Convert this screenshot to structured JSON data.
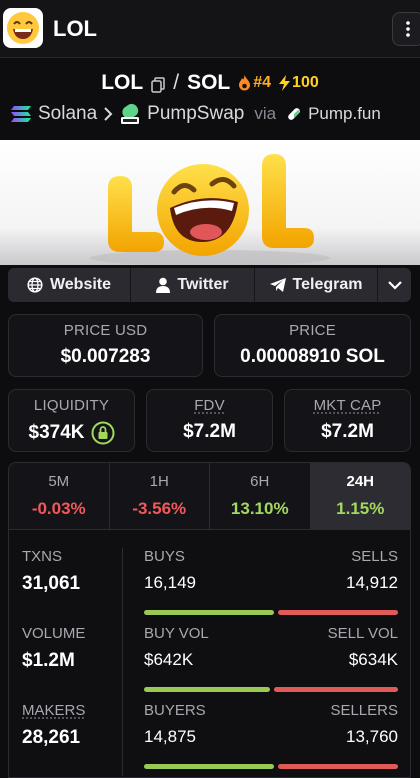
{
  "header": {
    "title": "LOL"
  },
  "pair": {
    "base": "LOL",
    "separator": "/",
    "quote": "SOL",
    "rank": "#4",
    "boosts": "100"
  },
  "chain": {
    "chain_name": "Solana",
    "dex_name": "PumpSwap",
    "via": "via",
    "launchpad": "Pump.fun"
  },
  "banner": {
    "logo_text": "LOL"
  },
  "links": [
    {
      "label": "Website",
      "icon": "globe-icon"
    },
    {
      "label": "Twitter",
      "icon": "person-icon"
    },
    {
      "label": "Telegram",
      "icon": "telegram-icon"
    }
  ],
  "prices": {
    "price_usd_label": "PRICE USD",
    "price_usd": "$0.007283",
    "price_label": "PRICE",
    "price_sol": "0.00008910 SOL"
  },
  "metrics": {
    "liquidity_label": "LIQUIDITY",
    "liquidity": "$374K",
    "fdv_label": "FDV",
    "fdv": "$7.2M",
    "mktcap_label": "MKT CAP",
    "mktcap": "$7.2M"
  },
  "timeframes": [
    {
      "name": "5M",
      "change": "-0.03%",
      "direction": "down"
    },
    {
      "name": "1H",
      "change": "-3.56%",
      "direction": "down"
    },
    {
      "name": "6H",
      "change": "13.10%",
      "direction": "up"
    },
    {
      "name": "24H",
      "change": "1.15%",
      "direction": "up",
      "selected": true
    }
  ],
  "stats": {
    "txns_label": "TXNS",
    "txns": "31,061",
    "buys_label": "BUYS",
    "buys": "16,149",
    "sells_label": "SELLS",
    "sells": "14,912",
    "buys_share": 0.52,
    "volume_label": "VOLUME",
    "volume": "$1.2M",
    "buy_vol_label": "BUY VOL",
    "buy_vol": "$642K",
    "sell_vol_label": "SELL VOL",
    "sell_vol": "$634K",
    "buy_vol_share": 0.503,
    "makers_label": "MAKERS",
    "makers": "28,261",
    "buyers_label": "BUYERS",
    "buyers": "14,875",
    "sellers_label": "SELLERS",
    "sellers": "13,760",
    "buyers_share": 0.52
  },
  "colors": {
    "positive": "#a3d85f",
    "negative": "#f2585a",
    "buy_bar": "#9bc955",
    "sell_bar": "#e05a57",
    "rank": "#ffb020",
    "boost": "#ffd21f"
  }
}
